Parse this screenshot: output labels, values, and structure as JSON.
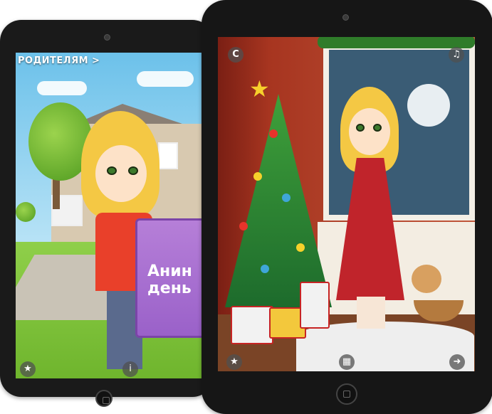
{
  "back_screen": {
    "parents_link": "РОДИТЕЛЯМ >",
    "book_title": "Анин\nдень",
    "star_button_icon": "star-icon",
    "info_button_icon": "info-icon"
  },
  "front_screen": {
    "restart_button_label": "C",
    "music_button_icon": "music-note-icon",
    "star_button_icon": "star-icon",
    "grid_button_icon": "grid-icon",
    "next_button_icon": "arrow-right-icon"
  },
  "colors": {
    "tablet_bezel": "#161616",
    "sky": "#6cc1ea",
    "grass": "#7fc23c",
    "book": "#a46bd0",
    "wall_red": "#a73520",
    "dress_red": "#c0242b"
  }
}
